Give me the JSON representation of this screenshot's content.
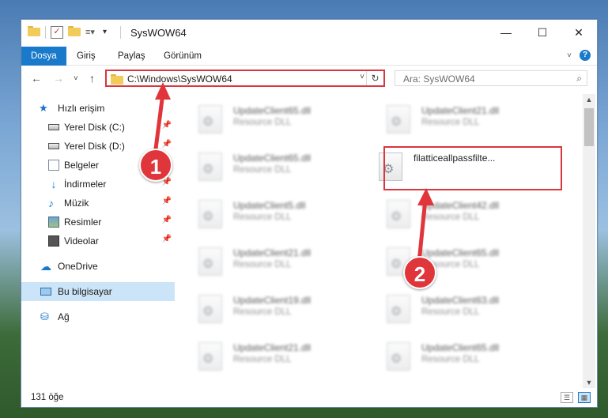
{
  "window": {
    "title": "SysWOW64",
    "controls": {
      "minimize": "—",
      "maximize": "☐",
      "close": "✕"
    }
  },
  "ribbon": {
    "tabs": [
      "Dosya",
      "Giriş",
      "Paylaş",
      "Görünüm"
    ],
    "active_tab": "Dosya",
    "active_color": "#1979ca"
  },
  "nav": {
    "back": "←",
    "forward": "→",
    "recent": "˅",
    "up": "↑",
    "address": "C:\\Windows\\SysWOW64",
    "address_highlight_color": "#d9363e",
    "search_placeholder": "Ara: SysWOW64"
  },
  "sidebar": {
    "items": [
      {
        "label": "Hızlı erişim",
        "icon": "star-icon",
        "pinned": false
      },
      {
        "label": "Yerel Disk (C:)",
        "icon": "drive-icon",
        "pinned": true
      },
      {
        "label": "Yerel Disk (D:)",
        "icon": "drive-icon",
        "pinned": true
      },
      {
        "label": "Belgeler",
        "icon": "documents-icon",
        "pinned": true
      },
      {
        "label": "İndirmeler",
        "icon": "downloads-icon",
        "pinned": true
      },
      {
        "label": "Müzik",
        "icon": "music-icon",
        "pinned": true
      },
      {
        "label": "Resimler",
        "icon": "pictures-icon",
        "pinned": true
      },
      {
        "label": "Videolar",
        "icon": "videos-icon",
        "pinned": true
      },
      {
        "label": "OneDrive",
        "icon": "cloud-icon",
        "pinned": false
      },
      {
        "label": "Bu bilgisayar",
        "icon": "computer-icon",
        "pinned": false,
        "selected": true
      },
      {
        "label": "Ağ",
        "icon": "network-icon",
        "pinned": false
      }
    ]
  },
  "files": [
    {
      "name": "UpdateClient65.dll",
      "type": "Resource DLL",
      "blurred": true
    },
    {
      "name": "UpdateClient21.dll",
      "type": "Resource DLL",
      "blurred": true
    },
    {
      "name": "UpdateClient65.dll",
      "type": "Resource DLL",
      "blurred": true
    },
    {
      "name": "filatticeallpassfilte...",
      "type": "",
      "blurred": false,
      "highlighted": true
    },
    {
      "name": "UpdateClient5.dll",
      "type": "Resource DLL",
      "blurred": true
    },
    {
      "name": "UpdateClient42.dll",
      "type": "Resource DLL",
      "blurred": true
    },
    {
      "name": "UpdateClient21.dll",
      "type": "Resource DLL",
      "blurred": true
    },
    {
      "name": "UpdateClient65.dll",
      "type": "Resource DLL",
      "blurred": true
    },
    {
      "name": "UpdateClient19.dll",
      "type": "Resource DLL",
      "blurred": true
    },
    {
      "name": "UpdateClient63.dll",
      "type": "Resource DLL",
      "blurred": true
    },
    {
      "name": "UpdateClient21.dll",
      "type": "Resource DLL",
      "blurred": true
    },
    {
      "name": "UpdateClient65.dll",
      "type": "Resource DLL",
      "blurred": true
    }
  ],
  "annotations": {
    "badge1": "1",
    "badge2": "2",
    "color": "#e0353b"
  },
  "status": {
    "count": "131 öğe"
  }
}
